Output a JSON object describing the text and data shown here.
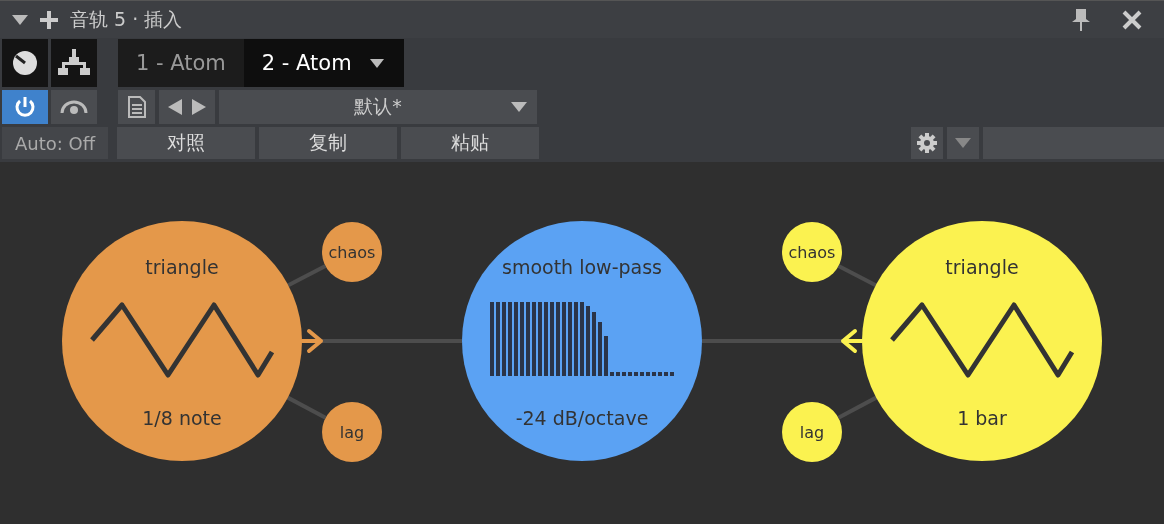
{
  "title_bar": {
    "title": "音轨 5 · 插入"
  },
  "tabs": [
    {
      "label": "1 - Atom",
      "selected": false
    },
    {
      "label": "2 - Atom",
      "selected": true
    }
  ],
  "power": {
    "on": true
  },
  "automation": {
    "label": "Auto: Off"
  },
  "preset": {
    "value": "默认*"
  },
  "preset_buttons": [
    "对照",
    "复制",
    "粘贴"
  ],
  "sources": [
    {
      "color": "#e4984a",
      "shape": "triangle",
      "rate": "1/8 note",
      "chaos": "chaos",
      "lag": "lag"
    },
    {
      "color": "#fbf250",
      "shape": "triangle",
      "rate": "1 bar",
      "chaos": "chaos",
      "lag": "lag"
    }
  ],
  "filter": {
    "color": "#5ba2f3",
    "mode": "smooth low-pass",
    "slope": "-24 dB/octave"
  }
}
